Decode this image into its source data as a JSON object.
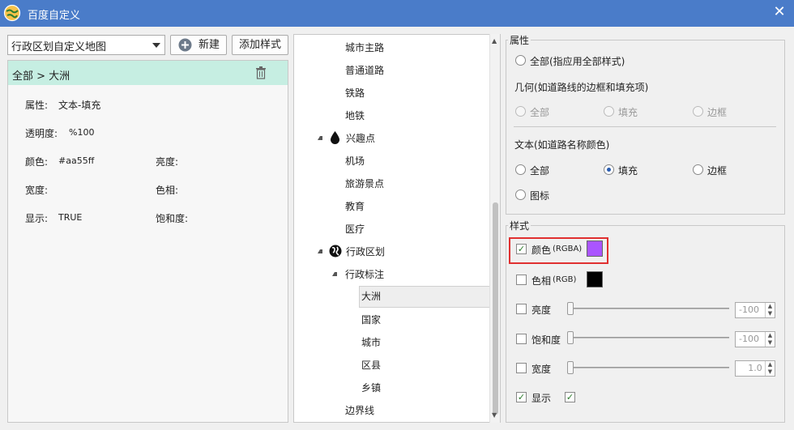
{
  "window": {
    "title": "百度自定义",
    "close_label": "✕"
  },
  "toolbar": {
    "map_select_value": "行政区划自定义地图",
    "new_button_label": "新建",
    "add_style_label": "添加样式"
  },
  "left": {
    "breadcrumb": "全部 > 大洲",
    "props": {
      "attr_label": "属性:",
      "attr_value": "文本-填充",
      "opacity_label": "透明度:",
      "opacity_value": "%100",
      "color_label": "颜色:",
      "color_value": "#aa55ff",
      "brightness_label": "亮度:",
      "width_label": "宽度:",
      "hue_label": "色相:",
      "visible_label": "显示:",
      "visible_value": "TRUE",
      "saturation_label": "饱和度:"
    }
  },
  "tree": {
    "items": [
      {
        "label": "城市主路"
      },
      {
        "label": "普通道路"
      },
      {
        "label": "铁路"
      },
      {
        "label": "地铁"
      },
      {
        "label": "兴趣点"
      },
      {
        "label": "机场"
      },
      {
        "label": "旅游景点"
      },
      {
        "label": "教育"
      },
      {
        "label": "医疗"
      },
      {
        "label": "行政区划"
      },
      {
        "label": "行政标注"
      },
      {
        "label": "大洲"
      },
      {
        "label": "国家"
      },
      {
        "label": "城市"
      },
      {
        "label": "区县"
      },
      {
        "label": "乡镇"
      },
      {
        "label": "边界线"
      }
    ]
  },
  "attributes": {
    "group_label": "属性",
    "all_label": "全部(指应用全部样式)",
    "geometry_title": "几何(如道路线的边框和填充项)",
    "geo_all": "全部",
    "geo_fill": "填充",
    "geo_border": "边框",
    "text_title": "文本(如道路名称颜色)",
    "text_all": "全部",
    "text_fill": "填充",
    "text_border": "边框",
    "icon_label": "图标"
  },
  "style": {
    "group_label": "样式",
    "color_label": "颜色",
    "color_suffix": "(RGBA)",
    "color_value": "#aa55ff",
    "hue_label": "色相",
    "hue_suffix": "(RGB)",
    "hue_value": "#000000",
    "brightness_label": "亮度",
    "brightness_value": "-100",
    "saturation_label": "饱和度",
    "saturation_value": "-100",
    "width_label": "宽度",
    "width_value": "1.0",
    "visible_label": "显示"
  }
}
